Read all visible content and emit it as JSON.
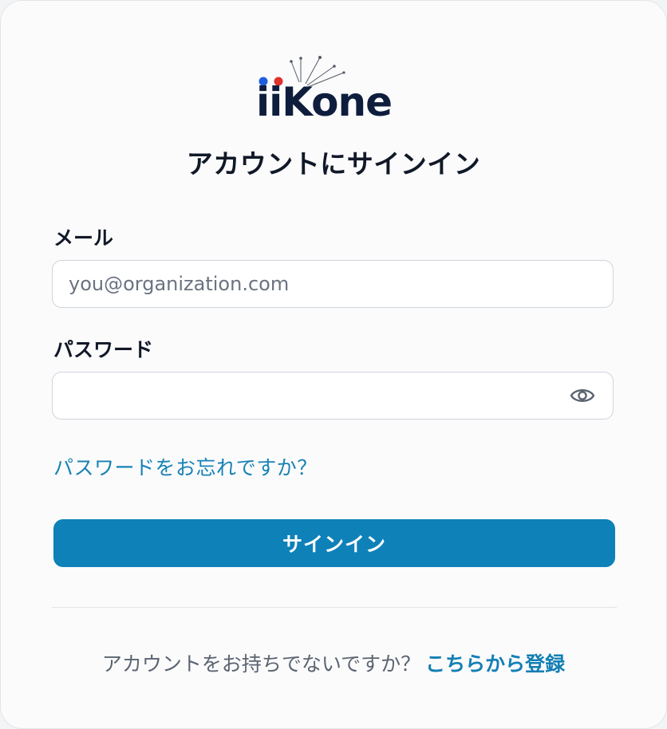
{
  "brand": {
    "name": "iiKone",
    "dot_colors": [
      "#1e5fe0",
      "#e0312b"
    ],
    "text_color": "#0f1d3d"
  },
  "title": "アカウントにサインイン",
  "email": {
    "label": "メール",
    "value": "",
    "placeholder": "you@organization.com"
  },
  "password": {
    "label": "パスワード",
    "value": "",
    "placeholder": "",
    "toggle_icon": "eye-icon"
  },
  "forgot_link": "パスワードをお忘れですか？",
  "signin_button": "サインイン",
  "footer": {
    "prompt": "アカウントをお持ちでないですか？",
    "register_link": "こちらから登録"
  },
  "colors": {
    "accent": "#0e81b8",
    "link": "#1882b4",
    "heading": "#111827",
    "muted": "#5b6470"
  }
}
